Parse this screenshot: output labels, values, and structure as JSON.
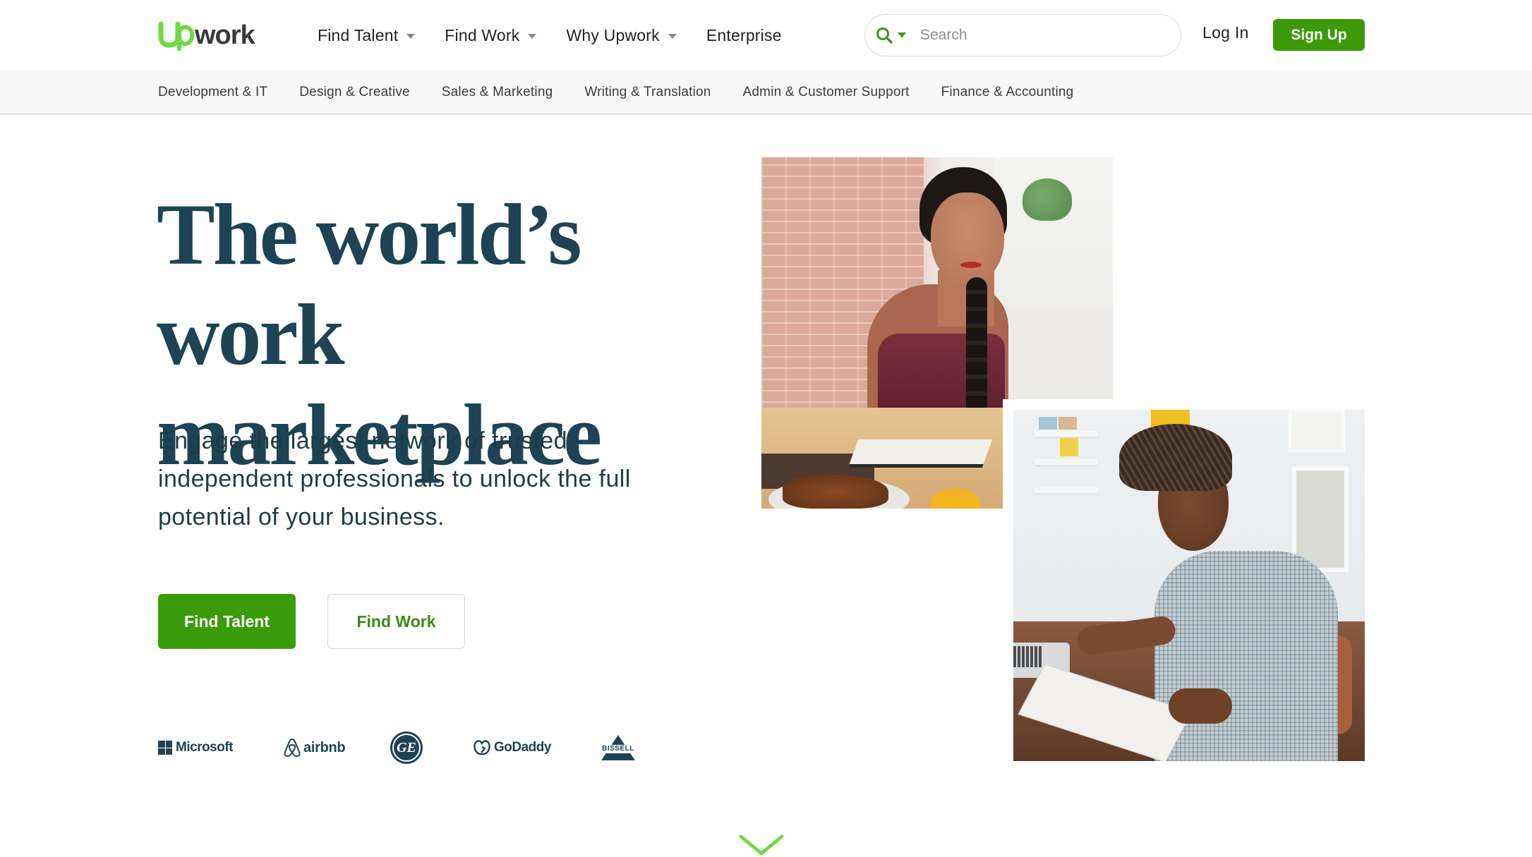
{
  "header": {
    "brand": {
      "name": "Upwork",
      "color_up": "#6fda44",
      "color_work": "#3a3a3a"
    },
    "nav": [
      {
        "label": "Find Talent",
        "has_dropdown": true
      },
      {
        "label": "Find Work",
        "has_dropdown": true
      },
      {
        "label": "Why Upwork",
        "has_dropdown": true
      },
      {
        "label": "Enterprise",
        "has_dropdown": false
      }
    ],
    "search": {
      "placeholder": "Search",
      "value": "",
      "icon": "search-icon",
      "accent": "#3c9a1d"
    },
    "login_label": "Log In",
    "signup_label": "Sign Up"
  },
  "categories": [
    "Development & IT",
    "Design & Creative",
    "Sales & Marketing",
    "Writing & Translation",
    "Admin & Customer Support",
    "Finance & Accounting"
  ],
  "hero": {
    "headline_line1": "The world’s work",
    "headline_line2": "marketplace",
    "subhead": "Engage the largest network of trusted independent professionals to unlock the full potential of your business.",
    "primary_cta": "Find Talent",
    "secondary_cta": "Find Work",
    "images": [
      {
        "alt": "Woman with braid smiling at a table with notebook and breakfast"
      },
      {
        "alt": "Young man with locs writing in a notebook beside a laptop"
      }
    ]
  },
  "trusted_by": [
    {
      "name": "Microsoft",
      "label": "Microsoft"
    },
    {
      "name": "airbnb",
      "label": "airbnb"
    },
    {
      "name": "GE",
      "label": "GE"
    },
    {
      "name": "GoDaddy",
      "label": "GoDaddy"
    },
    {
      "name": "Bissell",
      "label": "BISSELL"
    }
  ],
  "scroll_indicator": {
    "icon": "chevron-down-icon",
    "color": "#6fda44"
  },
  "colors": {
    "brand_green": "#3c9a0a",
    "headline": "#1d4354",
    "body_text": "#1d3c47"
  }
}
